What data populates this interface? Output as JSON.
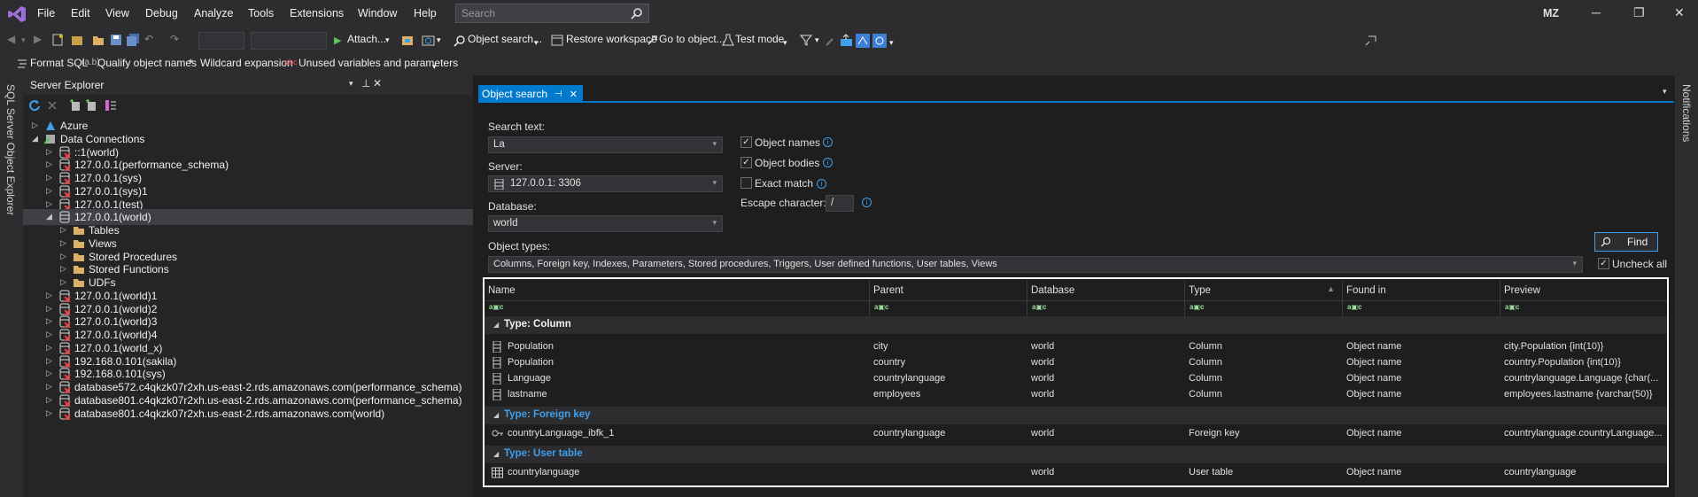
{
  "menu": {
    "items": [
      "File",
      "Edit",
      "View",
      "Debug",
      "Analyze",
      "Tools",
      "Extensions",
      "Window",
      "Help"
    ],
    "search_placeholder": "Search",
    "user_initials": "MZ"
  },
  "toolbar1": {
    "attach_label": "Attach...",
    "object_search_label": "Object search...",
    "restore_workspace_label": "Restore workspace",
    "go_to_object_label": "Go to object...",
    "test_mode_label": "Test mode"
  },
  "toolbar2": {
    "format_sql_label": "Format SQL",
    "qualify_label": "Qualify object names",
    "wildcard_label": "Wildcard expansion",
    "unused_label": "Unused variables and parameters"
  },
  "left_strip": {
    "label": "SQL Server Object Explorer"
  },
  "right_strip": {
    "label": "Notifications"
  },
  "server_explorer": {
    "title": "Server Explorer",
    "tree": [
      {
        "label": "Azure",
        "indent": 0,
        "arrow": "▷",
        "icon": "azure"
      },
      {
        "label": "Data Connections",
        "indent": 0,
        "arrow": "◢",
        "icon": "dataconn"
      },
      {
        "label": "::1(world)",
        "indent": 1,
        "arrow": "▷",
        "icon": "db-x"
      },
      {
        "label": "127.0.0.1(performance_schema)",
        "indent": 1,
        "arrow": "▷",
        "icon": "db-x"
      },
      {
        "label": "127.0.0.1(sys)",
        "indent": 1,
        "arrow": "▷",
        "icon": "db-x"
      },
      {
        "label": "127.0.0.1(sys)1",
        "indent": 1,
        "arrow": "▷",
        "icon": "db-x"
      },
      {
        "label": "127.0.0.1(test)",
        "indent": 1,
        "arrow": "▷",
        "icon": "db-x"
      },
      {
        "label": "127.0.0.1(world)",
        "indent": 1,
        "arrow": "◢",
        "icon": "db",
        "selected": true
      },
      {
        "label": "Tables",
        "indent": 2,
        "arrow": "▷",
        "icon": "folder"
      },
      {
        "label": "Views",
        "indent": 2,
        "arrow": "▷",
        "icon": "folder"
      },
      {
        "label": "Stored Procedures",
        "indent": 2,
        "arrow": "▷",
        "icon": "folder"
      },
      {
        "label": "Stored Functions",
        "indent": 2,
        "arrow": "▷",
        "icon": "folder"
      },
      {
        "label": "UDFs",
        "indent": 2,
        "arrow": "▷",
        "icon": "folder"
      },
      {
        "label": "127.0.0.1(world)1",
        "indent": 1,
        "arrow": "▷",
        "icon": "db-x"
      },
      {
        "label": "127.0.0.1(world)2",
        "indent": 1,
        "arrow": "▷",
        "icon": "db-x"
      },
      {
        "label": "127.0.0.1(world)3",
        "indent": 1,
        "arrow": "▷",
        "icon": "db-x"
      },
      {
        "label": "127.0.0.1(world)4",
        "indent": 1,
        "arrow": "▷",
        "icon": "db-x"
      },
      {
        "label": "127.0.0.1(world_x)",
        "indent": 1,
        "arrow": "▷",
        "icon": "db-x"
      },
      {
        "label": "192.168.0.101(sakila)",
        "indent": 1,
        "arrow": "▷",
        "icon": "db-x"
      },
      {
        "label": "192.168.0.101(sys)",
        "indent": 1,
        "arrow": "▷",
        "icon": "db-x"
      },
      {
        "label": "database572.c4qkzk07r2xh.us-east-2.rds.amazonaws.com(performance_schema)",
        "indent": 1,
        "arrow": "▷",
        "icon": "db-x"
      },
      {
        "label": "database801.c4qkzk07r2xh.us-east-2.rds.amazonaws.com(performance_schema)",
        "indent": 1,
        "arrow": "▷",
        "icon": "db-x"
      },
      {
        "label": "database801.c4qkzk07r2xh.us-east-2.rds.amazonaws.com(world)",
        "indent": 1,
        "arrow": "▷",
        "icon": "db-x"
      }
    ]
  },
  "object_search": {
    "tab_label": "Object search",
    "search_text_label": "Search text:",
    "search_text_value": "La",
    "server_label": "Server:",
    "server_value": "127.0.0.1: 3306",
    "database_label": "Database:",
    "database_value": "world",
    "object_names_label": "Object names",
    "object_bodies_label": "Object bodies",
    "exact_match_label": "Exact match",
    "escape_label": "Escape character:",
    "escape_value": "/",
    "object_types_label": "Object types:",
    "object_types_value": "Columns, Foreign key, Indexes, Parameters, Stored procedures, Triggers, User defined functions, User tables, Views",
    "find_label": "Find",
    "uncheck_all_label": "Uncheck all",
    "columns": [
      "Name",
      "Parent",
      "Database",
      "Type",
      "Found in",
      "Preview"
    ],
    "groups": [
      {
        "label": "Type: Column",
        "color": "#f1f1f1",
        "rows": [
          {
            "name": "Population",
            "parent": "city",
            "database": "world",
            "type": "Column",
            "found_in": "Object name",
            "preview": "city.Population {int(10)}",
            "icon": "column"
          },
          {
            "name": "Population",
            "parent": "country",
            "database": "world",
            "type": "Column",
            "found_in": "Object name",
            "preview": "country.Population {int(10)}",
            "icon": "column"
          },
          {
            "name": "Language",
            "parent": "countrylanguage",
            "database": "world",
            "type": "Column",
            "found_in": "Object name",
            "preview": "countrylanguage.Language {char(...",
            "icon": "column"
          },
          {
            "name": "lastname",
            "parent": "employees",
            "database": "world",
            "type": "Column",
            "found_in": "Object name",
            "preview": "employees.lastname {varchar(50)}",
            "icon": "column"
          }
        ]
      },
      {
        "label": "Type: Foreign key",
        "color": "#3e9fea",
        "rows": [
          {
            "name": "countryLanguage_ibfk_1",
            "parent": "countrylanguage",
            "database": "world",
            "type": "Foreign key",
            "found_in": "Object name",
            "preview": "countrylanguage.countryLanguage...",
            "icon": "key"
          }
        ]
      },
      {
        "label": "Type: User table",
        "color": "#3e9fea",
        "rows": [
          {
            "name": "countrylanguage",
            "parent": "",
            "database": "world",
            "type": "User table",
            "found_in": "Object name",
            "preview": "countrylanguage",
            "icon": "table"
          }
        ]
      }
    ]
  }
}
